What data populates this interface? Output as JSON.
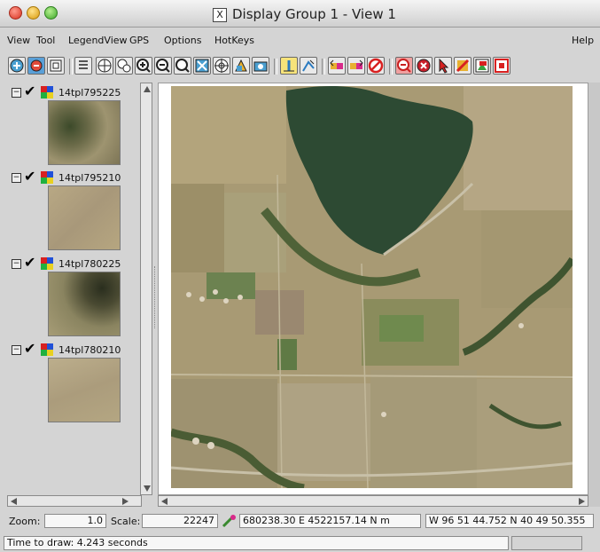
{
  "window": {
    "title": "Display Group 1 - View 1",
    "title_icon": "x11-icon"
  },
  "menu": [
    "View",
    "Tool",
    "LegendView",
    "GPS",
    "Options",
    "HotKeys"
  ],
  "help_label": "Help",
  "layers": [
    {
      "name": "14tpl795225",
      "checked": true
    },
    {
      "name": "14tpl795210",
      "checked": true
    },
    {
      "name": "14tpl780225",
      "checked": true
    },
    {
      "name": "14tpl780210",
      "checked": true
    }
  ],
  "status": {
    "zoom_label": "Zoom:",
    "zoom_value": "1.0",
    "scale_label": "Scale:",
    "scale_value": "22247",
    "utm": "680238.30 E  4522157.14 N m",
    "latlon": "W 96 51 44.752  N 40 49 50.355",
    "draw_time": "Time to draw: 4.243 seconds"
  },
  "toolbar_icons": [
    "pan-icon",
    "zoom-icon",
    "fit-icon",
    "legend-icon",
    "move-icon",
    "zoom-in-icon",
    "zoom-out-icon",
    "zoom-rect-icon",
    "refresh-icon",
    "target-icon",
    "overview-icon",
    "camera-icon",
    "measure-icon",
    "profile-icon",
    "back-icon",
    "forward-icon",
    "clear-icon",
    "zoom-layer-icon",
    "stop-icon",
    "select-icon",
    "edit-icon",
    "query-icon",
    "box-icon"
  ]
}
